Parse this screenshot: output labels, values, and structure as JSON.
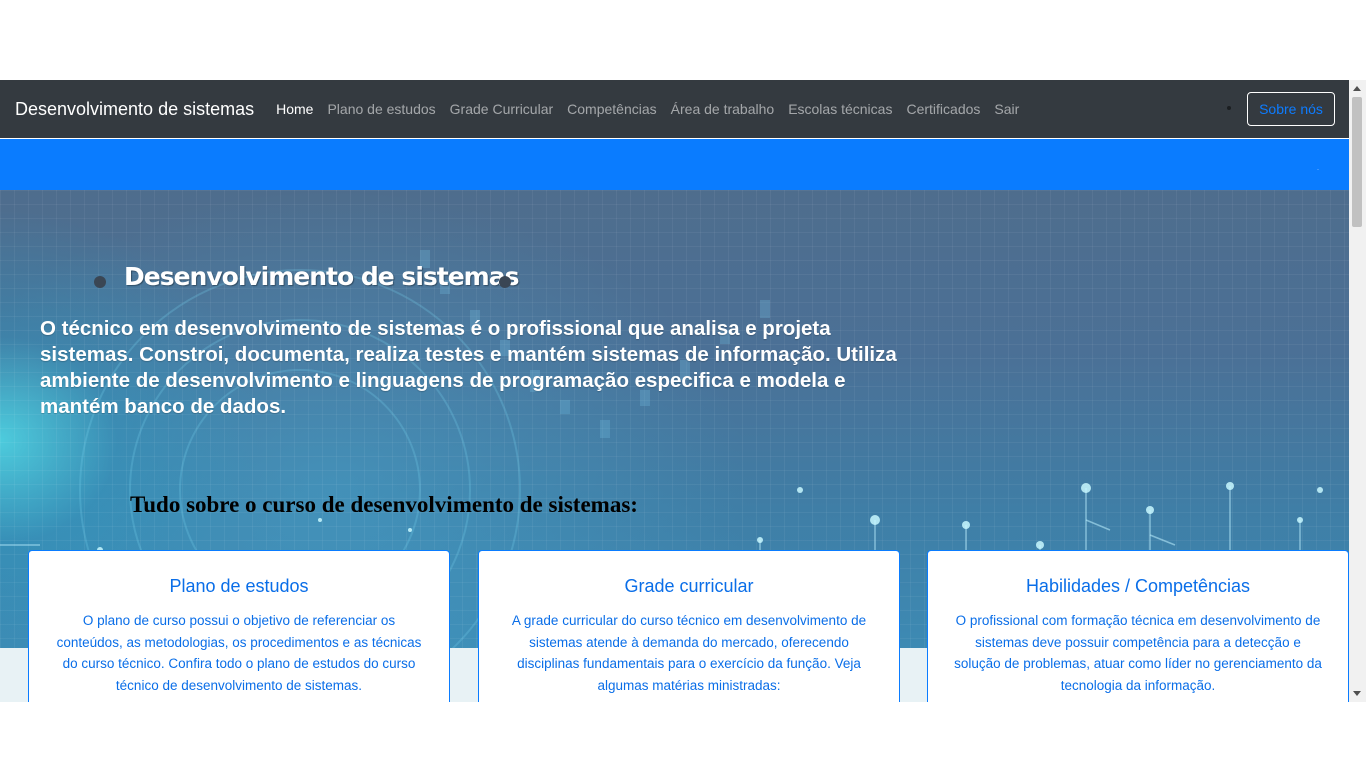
{
  "navbar": {
    "brand": "Desenvolvimento de sistemas",
    "links": [
      "Home",
      "Plano de estudos",
      "Grade Curricular",
      "Competências",
      "Área de trabalho",
      "Escolas técnicas",
      "Certificados",
      "Sair"
    ],
    "active_link": "Home",
    "about_button": "Sobre nós"
  },
  "hero": {
    "title": "Desenvolvimento de sistemas",
    "description": "O técnico em desenvolvimento de sistemas é o profissional que analisa e projeta sistemas. Constroi, documenta, realiza testes e mantém sistemas de informação. Utiliza ambiente de desenvolvimento e linguagens de programação especifica e modela e mantém banco de dados."
  },
  "section": {
    "title": "Tudo sobre o curso de desenvolvimento de sistemas:"
  },
  "cards": [
    {
      "title": "Plano de estudos",
      "text": "O plano de curso possui o objetivo de referenciar os conteúdos, as metodologias, os procedimentos e as técnicas do curso técnico. Confira todo o plano de estudos do curso técnico de desenvolvimento de sistemas."
    },
    {
      "title": "Grade curricular",
      "text": "A grade curricular do curso técnico em desenvolvimento de sistemas atende à demanda do mercado, oferecendo disciplinas fundamentais para o exercício da função. Veja algumas matérias ministradas:"
    },
    {
      "title": "Habilidades / Competências",
      "text": "O profissional com formação técnica em desenvolvimento de sistemas deve possuir competência para a detecção e solução de problemas, atuar como líder no gerenciamento da tecnologia da informação."
    }
  ],
  "colors": {
    "navbar": "#343a40",
    "accent_blue": "#0a7cff",
    "card_text": "#0a6ee8"
  }
}
